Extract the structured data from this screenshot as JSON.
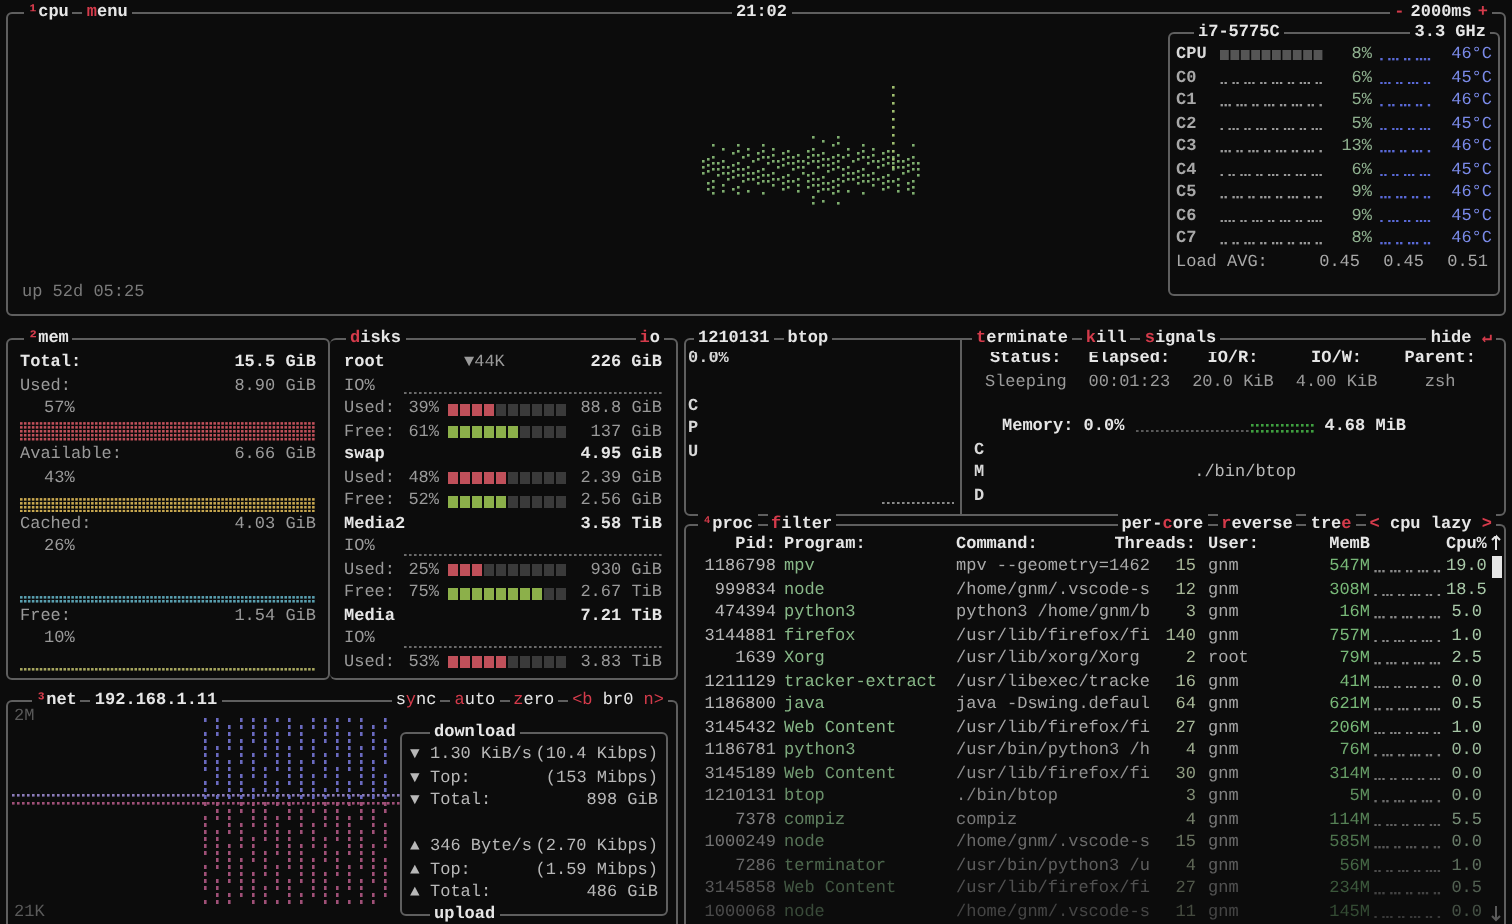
{
  "cpu_panel": {
    "tabs": [
      {
        "parts": [
          {
            "kind": "key",
            "text": "¹"
          },
          {
            "kind": "plain",
            "text": "cpu"
          }
        ]
      },
      {
        "parts": [
          {
            "kind": "key",
            "text": "m"
          },
          {
            "kind": "plain",
            "text": "enu"
          }
        ]
      }
    ],
    "clock": "21:02",
    "interval": {
      "minus": "-",
      "value": "2000ms",
      "plus": "+"
    },
    "uptime": "up 52d 05:25",
    "cpu_box": {
      "model": "i7-5775C",
      "frequency": "3.3 GHz",
      "rows": [
        {
          "kind": "total",
          "name": "CPU",
          "percent": "8%",
          "temp": "46°C"
        },
        {
          "kind": "core",
          "name": "C0",
          "percent": "6%",
          "temp": "45°C"
        },
        {
          "kind": "core",
          "name": "C1",
          "percent": "5%",
          "temp": "46°C"
        },
        {
          "kind": "core",
          "name": "C2",
          "percent": "5%",
          "temp": "45°C"
        },
        {
          "kind": "core",
          "name": "C3",
          "percent": "13%",
          "temp": "46°C"
        },
        {
          "kind": "core",
          "name": "C4",
          "percent": "6%",
          "temp": "45°C"
        },
        {
          "kind": "core",
          "name": "C5",
          "percent": "9%",
          "temp": "46°C"
        },
        {
          "kind": "core",
          "name": "C6",
          "percent": "9%",
          "temp": "45°C"
        },
        {
          "kind": "core",
          "name": "C7",
          "percent": "8%",
          "temp": "46°C"
        }
      ],
      "load_label": "Load AVG:",
      "load": [
        "0.45",
        "0.45",
        "0.51"
      ]
    }
  },
  "mem_panel": {
    "tab": {
      "parts": [
        {
          "kind": "key",
          "text": "²"
        },
        {
          "kind": "plain",
          "text": "mem"
        }
      ]
    },
    "total_label": "Total:",
    "total": "15.5 GiB",
    "items": [
      {
        "label": "Used:",
        "value": "8.90 GiB",
        "percent": "57%",
        "color": "#c0505a"
      },
      {
        "label": "Available:",
        "value": "6.66 GiB",
        "percent": "43%",
        "color": "#c8a850"
      },
      {
        "label": "Cached:",
        "value": "4.03 GiB",
        "percent": "26%",
        "color": "#5aa0b0"
      },
      {
        "label": "Free:",
        "value": "1.54 GiB",
        "percent": "10%",
        "color": "#a8a860"
      }
    ]
  },
  "disks_panel": {
    "tab": {
      "parts": [
        {
          "kind": "key",
          "text": "d"
        },
        {
          "kind": "plain",
          "text": "isks"
        }
      ]
    },
    "io_tab": {
      "parts": [
        {
          "kind": "key",
          "text": "i"
        },
        {
          "kind": "plain",
          "text": "o"
        }
      ]
    },
    "disks": [
      {
        "name": "root",
        "io": "▼44K",
        "size": "226 GiB",
        "io_label": "IO%",
        "used": {
          "label": "Used:",
          "percent": "39%",
          "level": 0.39,
          "value": "88.8 GiB"
        },
        "free": {
          "label": "Free:",
          "percent": "61%",
          "level": 0.61,
          "value": "137 GiB"
        }
      },
      {
        "name": "swap",
        "size": "4.95 GiB",
        "used": {
          "label": "Used:",
          "percent": "48%",
          "level": 0.48,
          "value": "2.39 GiB"
        },
        "free": {
          "label": "Free:",
          "percent": "52%",
          "level": 0.52,
          "value": "2.56 GiB"
        }
      },
      {
        "name": "Media2",
        "size": "3.58 TiB",
        "io_label": "IO%",
        "used": {
          "label": "Used:",
          "percent": "25%",
          "level": 0.25,
          "value": "930 GiB"
        },
        "free": {
          "label": "Free:",
          "percent": "75%",
          "level": 0.75,
          "value": "2.67 TiB"
        }
      },
      {
        "name": "Media",
        "size": "7.21 TiB",
        "io_label": "IO%",
        "used": {
          "label": "Used:",
          "percent": "53%",
          "level": 0.53,
          "value": "3.83 TiB"
        }
      }
    ]
  },
  "detail_panel": {
    "pid": "1210131",
    "name": "btop",
    "cpu_percent": "0.0%",
    "cpu_label": "CPU",
    "tabs": [
      {
        "parts": [
          {
            "kind": "key",
            "text": "t"
          },
          {
            "kind": "plain",
            "text": "erminate"
          }
        ]
      },
      {
        "parts": [
          {
            "kind": "key",
            "text": "k"
          },
          {
            "kind": "plain",
            "text": "ill"
          }
        ]
      },
      {
        "parts": [
          {
            "kind": "key",
            "text": "s"
          },
          {
            "kind": "plain",
            "text": "ignals"
          }
        ]
      }
    ],
    "hide": {
      "parts": [
        {
          "kind": "plain",
          "text": "hide "
        },
        {
          "kind": "key",
          "text": "↵"
        }
      ]
    },
    "fields": [
      {
        "label": "Status:",
        "value": "Sleeping"
      },
      {
        "label": "Elapsed:",
        "value": "00:01:23"
      },
      {
        "label": "IO/R:",
        "value": "20.0 KiB"
      },
      {
        "label": "IO/W:",
        "value": "4.00 KiB"
      },
      {
        "label": "Parent:",
        "value": "zsh"
      }
    ],
    "memory_label": "Memory: 0.0%",
    "memory_value": "4.68 MiB",
    "cmd_label": "CMD",
    "command": "./bin/btop"
  },
  "proc_panel": {
    "tabs": [
      {
        "parts": [
          {
            "kind": "key",
            "text": "⁴"
          },
          {
            "kind": "plain",
            "text": "proc"
          }
        ]
      },
      {
        "parts": [
          {
            "kind": "key",
            "text": "f"
          },
          {
            "kind": "plain",
            "text": "ilter"
          }
        ]
      }
    ],
    "options": [
      {
        "parts": [
          {
            "kind": "plain",
            "text": "per-"
          },
          {
            "kind": "key",
            "text": "c"
          },
          {
            "kind": "plain",
            "text": "ore"
          }
        ]
      },
      {
        "parts": [
          {
            "kind": "key",
            "text": "r"
          },
          {
            "kind": "plain",
            "text": "everse"
          }
        ]
      },
      {
        "parts": [
          {
            "kind": "plain",
            "text": "tre"
          },
          {
            "kind": "key",
            "text": "e"
          }
        ]
      },
      {
        "parts": [
          {
            "kind": "key",
            "text": "<"
          },
          {
            "kind": "plain",
            "text": " cpu lazy "
          },
          {
            "kind": "key",
            "text": ">"
          }
        ]
      }
    ],
    "columns": [
      "Pid:",
      "Program:",
      "Command:",
      "Threads:",
      "User:",
      "MemB",
      "Cpu%"
    ],
    "rows": [
      {
        "pid": "1186798",
        "program": "mpv",
        "command": "mpv --geometry=1462",
        "threads": "15",
        "user": "gnm",
        "mem": "547M",
        "cpu": "19.0"
      },
      {
        "pid": "999834",
        "program": "node",
        "command": "/home/gnm/.vscode-s",
        "threads": "12",
        "user": "gnm",
        "mem": "308M",
        "cpu": "18.5"
      },
      {
        "pid": "474394",
        "program": "python3",
        "command": "python3 /home/gnm/b",
        "threads": "3",
        "user": "gnm",
        "mem": "16M",
        "cpu": "5.0"
      },
      {
        "pid": "3144881",
        "program": "firefox",
        "command": "/usr/lib/firefox/fi",
        "threads": "140",
        "user": "gnm",
        "mem": "757M",
        "cpu": "1.0"
      },
      {
        "pid": "1639",
        "program": "Xorg",
        "command": "/usr/lib/xorg/Xorg",
        "threads": "2",
        "user": "root",
        "mem": "79M",
        "cpu": "2.5"
      },
      {
        "pid": "1211129",
        "program": "tracker-extract",
        "command": "/usr/libexec/tracke",
        "threads": "16",
        "user": "gnm",
        "mem": "41M",
        "cpu": "0.0"
      },
      {
        "pid": "1186800",
        "program": "java",
        "command": "java -Dswing.defaul",
        "threads": "64",
        "user": "gnm",
        "mem": "621M",
        "cpu": "0.5"
      },
      {
        "pid": "3145432",
        "program": "Web Content",
        "command": "/usr/lib/firefox/fi",
        "threads": "27",
        "user": "gnm",
        "mem": "206M",
        "cpu": "1.0"
      },
      {
        "pid": "1186781",
        "program": "python3",
        "command": "/usr/bin/python3 /h",
        "threads": "4",
        "user": "gnm",
        "mem": "76M",
        "cpu": "0.0"
      },
      {
        "pid": "3145189",
        "program": "Web Content",
        "command": "/usr/lib/firefox/fi",
        "threads": "30",
        "user": "gnm",
        "mem": "314M",
        "cpu": "0.0"
      },
      {
        "pid": "1210131",
        "program": "btop",
        "command": "./bin/btop",
        "threads": "3",
        "user": "gnm",
        "mem": "5M",
        "cpu": "0.0"
      },
      {
        "pid": "7378",
        "program": "compiz",
        "command": "compiz",
        "threads": "4",
        "user": "gnm",
        "mem": "114M",
        "cpu": "5.5"
      },
      {
        "pid": "1000249",
        "program": "node",
        "command": "/home/gnm/.vscode-s",
        "threads": "15",
        "user": "gnm",
        "mem": "585M",
        "cpu": "0.0"
      },
      {
        "pid": "7286",
        "program": "terminator",
        "command": "/usr/bin/python3 /u",
        "threads": "4",
        "user": "gnm",
        "mem": "56M",
        "cpu": "1.0"
      },
      {
        "pid": "3145858",
        "program": "Web Content",
        "command": "/usr/lib/firefox/fi",
        "threads": "27",
        "user": "gnm",
        "mem": "234M",
        "cpu": "0.5"
      },
      {
        "pid": "1000068",
        "program": "node",
        "command": "/home/gnm/.vscode-s",
        "threads": "11",
        "user": "gnm",
        "mem": "145M",
        "cpu": "0.0"
      }
    ]
  },
  "net_panel": {
    "tabs": [
      {
        "parts": [
          {
            "kind": "key",
            "text": "³"
          },
          {
            "kind": "plain",
            "text": "net"
          }
        ]
      },
      {
        "parts": [
          {
            "kind": "plain",
            "text": "192.168.1.11"
          }
        ]
      }
    ],
    "options": [
      {
        "parts": [
          {
            "kind": "plain",
            "text": "s"
          },
          {
            "kind": "key",
            "text": "y"
          },
          {
            "kind": "plain",
            "text": "nc"
          }
        ]
      },
      {
        "parts": [
          {
            "kind": "key",
            "text": "a"
          },
          {
            "kind": "plain",
            "text": "uto"
          }
        ]
      },
      {
        "parts": [
          {
            "kind": "key",
            "text": "z"
          },
          {
            "kind": "plain",
            "text": "ero"
          }
        ]
      },
      {
        "parts": [
          {
            "kind": "key",
            "text": "<b"
          },
          {
            "kind": "plain",
            "text": " br0 "
          },
          {
            "kind": "key",
            "text": "n>"
          }
        ]
      }
    ],
    "scale_top": "2M",
    "scale_bottom": "21K",
    "download": {
      "title": "download",
      "rows": [
        {
          "arrow": "▼",
          "label": "1.30 KiB/s",
          "value": "(10.4 Kibps)"
        },
        {
          "arrow": "▼",
          "label": "Top:",
          "value": "(153 Mibps)"
        },
        {
          "arrow": "▼",
          "label": "Total:",
          "value": "898 GiB"
        }
      ]
    },
    "upload": {
      "title": "upload",
      "rows": [
        {
          "arrow": "▲",
          "label": "346 Byte/s",
          "value": "(2.70 Kibps)"
        },
        {
          "arrow": "▲",
          "label": "Top:",
          "value": "(1.59 Mibps)"
        },
        {
          "arrow": "▲",
          "label": "Total:",
          "value": "486 GiB"
        }
      ]
    }
  }
}
